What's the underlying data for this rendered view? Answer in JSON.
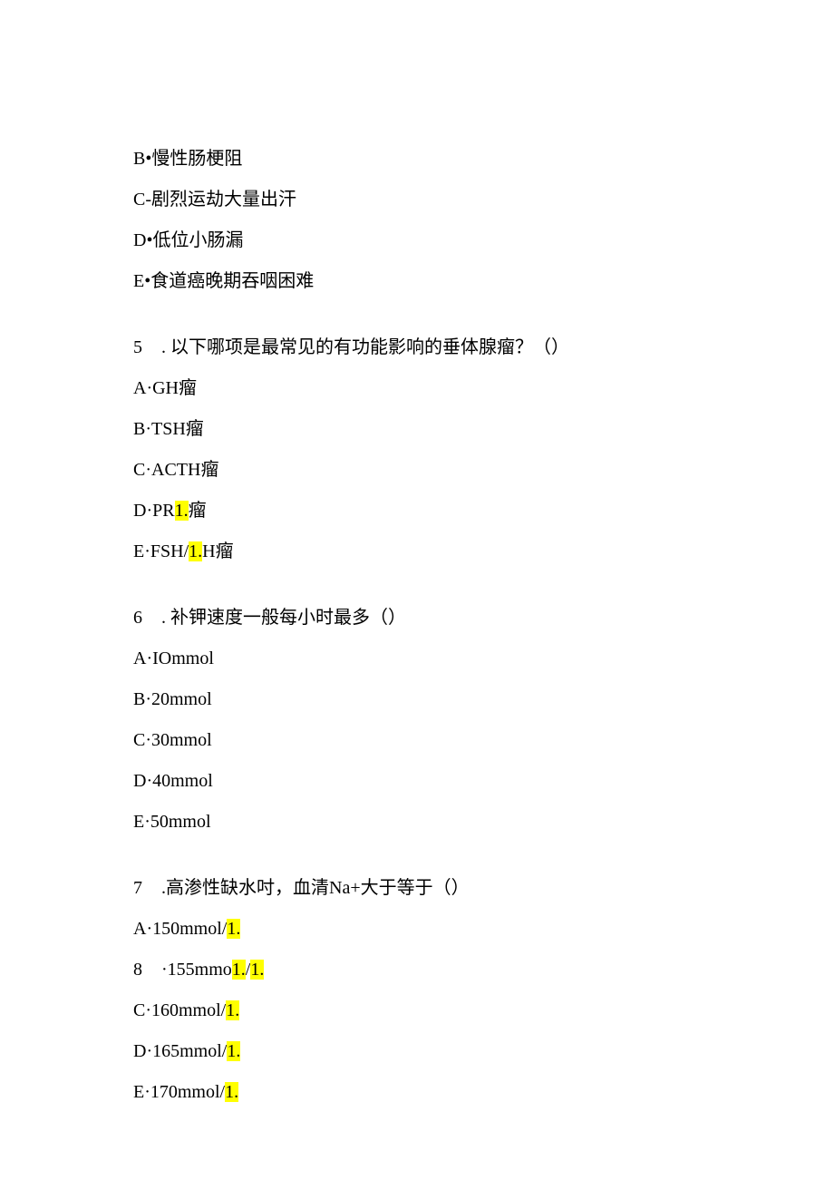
{
  "partial_options_prev": {
    "b": "B•慢性肠梗阻",
    "c": "C-剧烈运劫大量出汗",
    "d": "D•低位小肠漏",
    "e": "E•食道癌晚期吞咽困难"
  },
  "q5": {
    "num": "5",
    "sep": " .",
    "text": "以下哪项是最常见的有功能影响的垂体腺瘤？（）",
    "a": "A·GH瘤",
    "b": "B·TSH瘤",
    "c": "C·ACTH瘤",
    "d_pre": "D·PR",
    "d_hl": "1.",
    "d_post": "瘤",
    "e_pre": "E·FSH/",
    "e_hl": "1.",
    "e_post": "H瘤"
  },
  "q6": {
    "num": "6",
    "sep": " .",
    "text": "补钾速度一般每小时最多（）",
    "a": "A·IOmmol",
    "b": "B·20mmol",
    "c": "C·30mmol",
    "d": "D·40mmol",
    "e": "E·50mmol"
  },
  "q7": {
    "num": "7",
    "sep": " .",
    "text": "高渗性缺水吋，血清Na+大于等于（）",
    "a_pre": "A·150mmol/",
    "a_hl": "1.",
    "b_num": "8",
    "b_sep": " ·",
    "b_pre": "155mmo",
    "b_hl1": "1.",
    "b_mid": "/",
    "b_hl2": "1.",
    "c_pre": "C·160mmol/",
    "c_hl": "1.",
    "d_pre": "D·165mmol/",
    "d_hl": "1.",
    "e_pre": "E·170mmol/",
    "e_hl": "1."
  }
}
